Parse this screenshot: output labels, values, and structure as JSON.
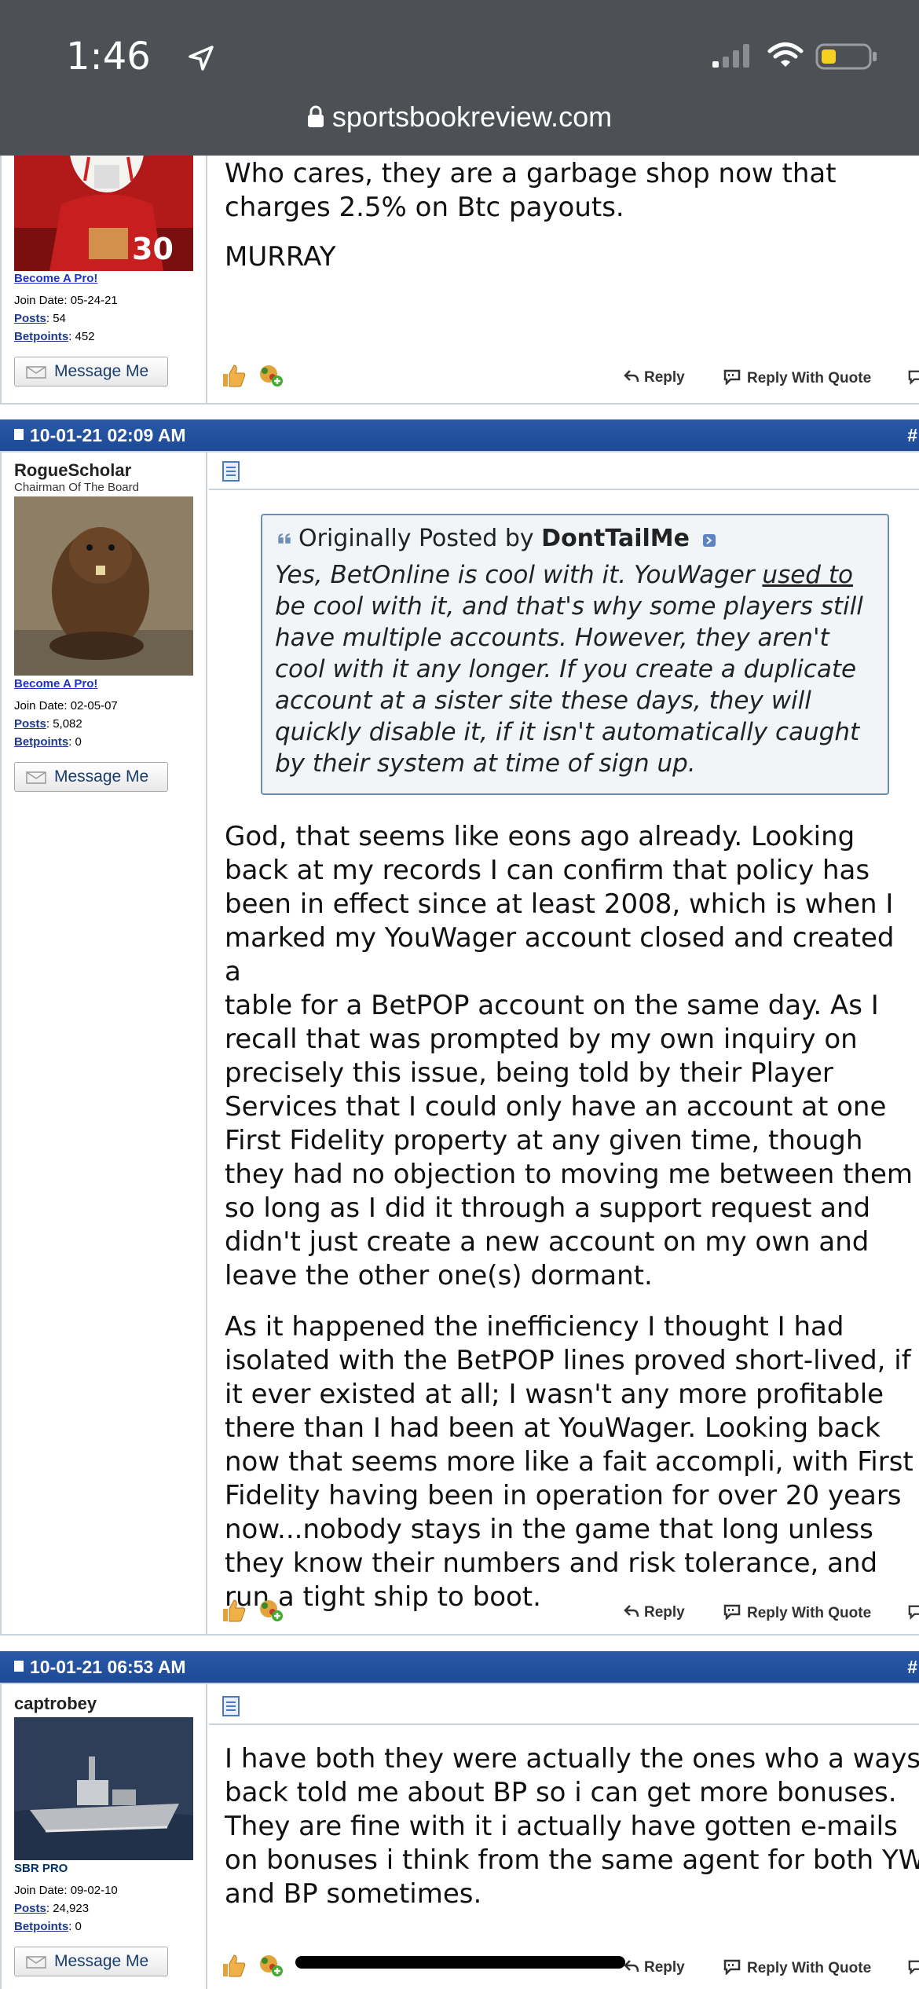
{
  "status_bar": {
    "time": "1:46",
    "url": "sportsbookreview.com"
  },
  "colors": {
    "post_header": "#2257a3",
    "link": "#1f33c8",
    "status_bar": "#4d5156"
  },
  "posts": [
    {
      "user": {
        "become_pro": "Become A Pro!",
        "join_date": "Join Date: 05-24-21",
        "posts_label": "Posts",
        "posts": ": 54",
        "betpoints_label": "Betpoints",
        "betpoints": ": 452",
        "message_button": "Message Me"
      },
      "body": [
        "Who cares, they are a garbage shop now that",
        "charges 2.5% on Btc payouts.",
        "",
        "MURRAY"
      ],
      "actions": {
        "reply": "Reply",
        "reply_quote": "Reply With Quote"
      }
    },
    {
      "header": {
        "datetime": "10-01-21 02:09 AM",
        "hash": "#"
      },
      "user": {
        "username": "RogueScholar",
        "title": "Chairman Of The Board",
        "become_pro": "Become A Pro!",
        "join_date": "Join Date: 02-05-07",
        "posts_label": "Posts",
        "posts": ": 5,082",
        "betpoints_label": "Betpoints",
        "betpoints": ": 0",
        "message_button": "Message Me"
      },
      "quote": {
        "prefix": "Originally Posted by",
        "author": "DontTailMe",
        "lines_before_link": "Yes, BetOnline is cool with it. YouWager ",
        "link_text": "used to",
        "lines": [
          "be cool with it, and that's why some players still",
          "have multiple accounts. However, they aren't",
          "cool with it any longer. If you create a duplicate",
          "account at a sister site these days, they will",
          "quickly disable it, if it isn't automatically caught",
          "by their system at time of sign up."
        ]
      },
      "paragraph1": [
        "God, that seems like eons ago already. Looking",
        "back at my records I can confirm that policy has",
        "been in effect since at least 2008, which is when I",
        "marked my YouWager account closed and created a",
        "table for a BetPOP account on the same day. As I",
        "recall that was prompted by my own inquiry on",
        "precisely this issue, being told by their Player",
        "Services that I could only have an account at one",
        "First Fidelity property at any given time, though",
        "they had no objection to moving me between them",
        "so long as I did it through a support request and",
        "didn't just create a new account on my own and",
        "leave the other one(s) dormant."
      ],
      "paragraph2": [
        "As it happened the inefficiency I thought I had",
        "isolated with the BetPOP lines proved short-lived, if",
        "it ever existed at all; I wasn't any more profitable",
        "there than I had been at YouWager. Looking back",
        "now that seems more like a fait accompli, with First",
        "Fidelity having been in operation for over 20 years",
        "now...nobody stays in the game that long unless",
        "they know their numbers and risk tolerance, and",
        "run a tight ship to boot."
      ],
      "actions": {
        "reply": "Reply",
        "reply_quote": "Reply With Quote"
      }
    },
    {
      "header": {
        "datetime": "10-01-21 06:53 AM",
        "hash": "#"
      },
      "user": {
        "username": "captrobey",
        "title": "SBR PRO",
        "join_date": "Join Date: 09-02-10",
        "posts_label": "Posts",
        "posts": ": 24,923",
        "betpoints_label": "Betpoints",
        "betpoints": ": 0",
        "message_button": "Message Me"
      },
      "body": [
        "I have both they were actually the ones who a ways",
        "back told me about BP so i can get more bonuses.",
        "They are fine with it i actually have gotten e-mails",
        "on bonuses i think from the same agent for both YW",
        "and BP sometimes."
      ],
      "actions": {
        "reply": "Reply",
        "reply_quote": "Reply With Quote"
      }
    }
  ]
}
